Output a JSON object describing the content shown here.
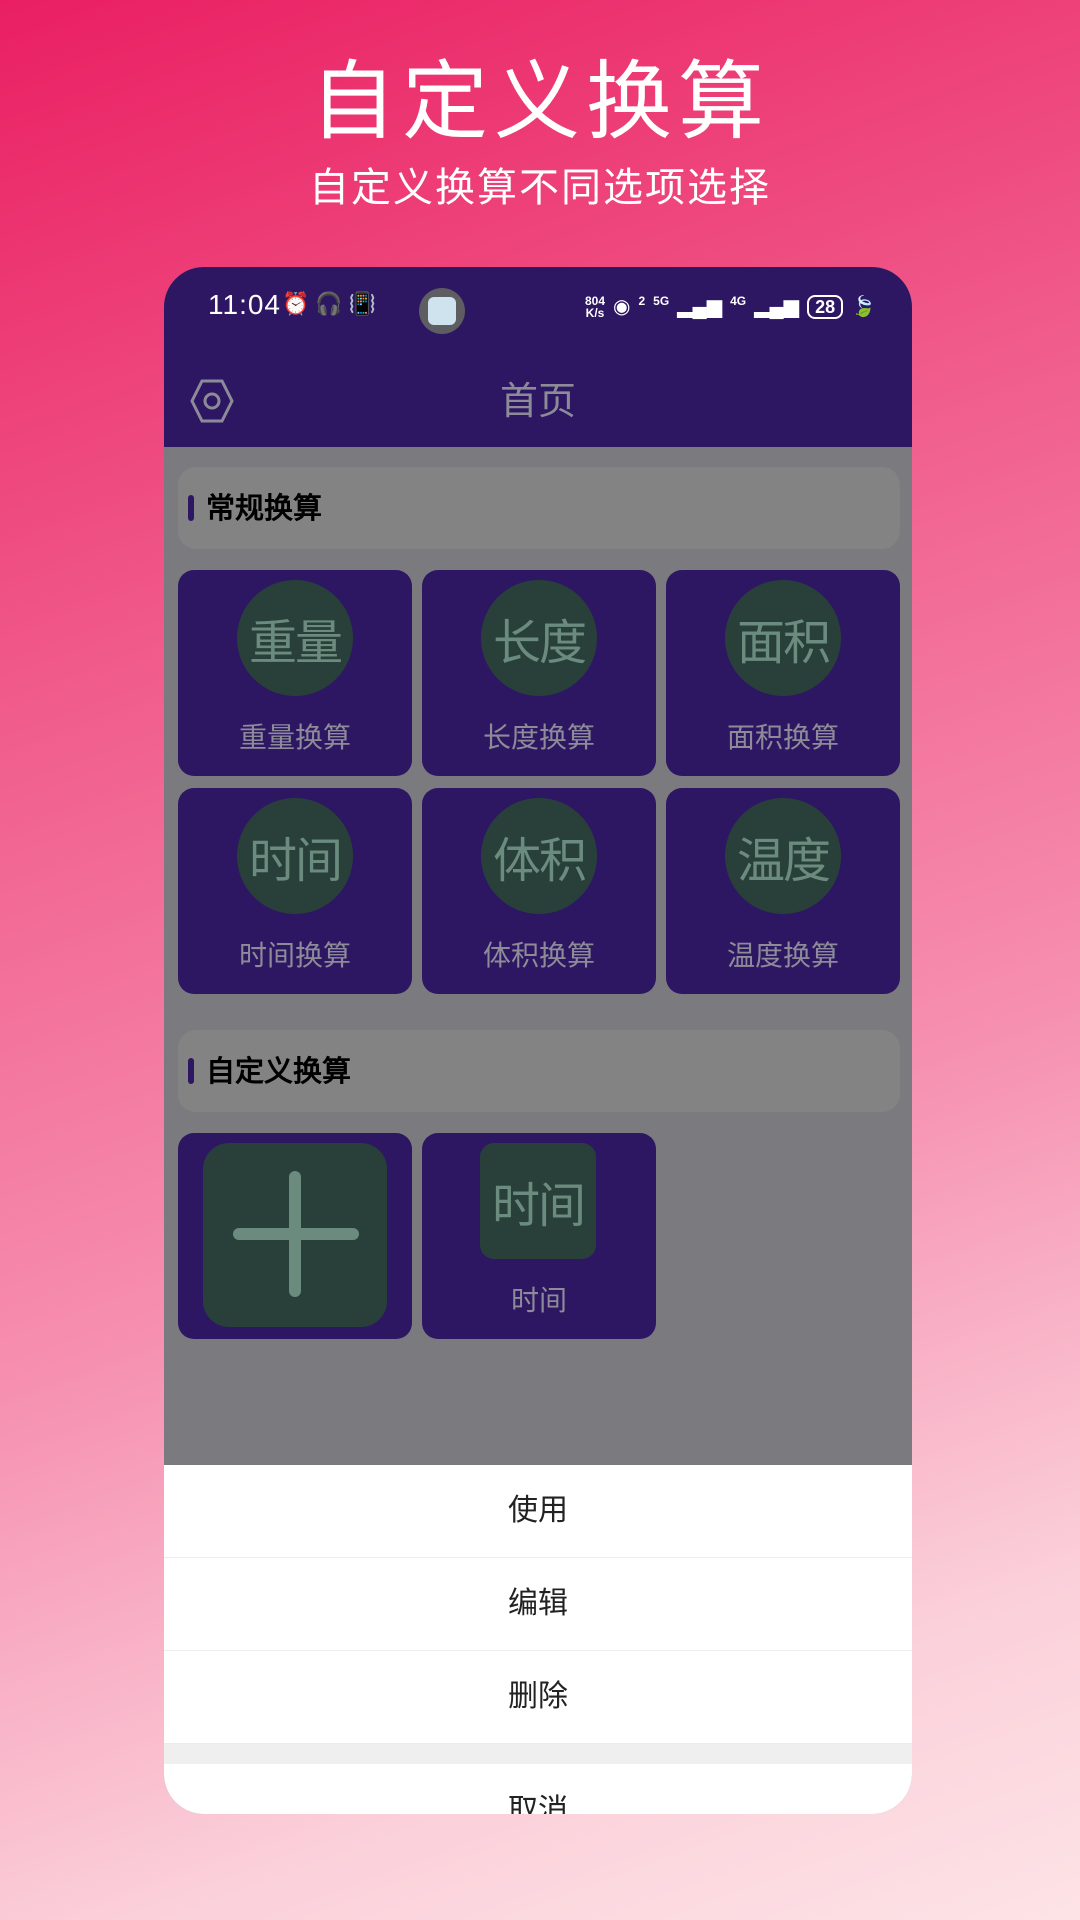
{
  "promo": {
    "title": "自定义换算",
    "subtitle": "自定义换算不同选项选择"
  },
  "status_bar": {
    "time": "11:04",
    "net_speed_value": "804",
    "net_speed_unit": "K/s",
    "sim1_label": "5G",
    "sim1_index": "2",
    "sim2_label": "4G",
    "battery": "28"
  },
  "nav": {
    "title": "首页"
  },
  "sections": {
    "regular": "常规换算",
    "custom": "自定义换算"
  },
  "regular_cards": [
    {
      "icon_text": "重量",
      "label": "重量换算"
    },
    {
      "icon_text": "长度",
      "label": "长度换算"
    },
    {
      "icon_text": "面积",
      "label": "面积换算"
    },
    {
      "icon_text": "时间",
      "label": "时间换算"
    },
    {
      "icon_text": "体积",
      "label": "体积换算"
    },
    {
      "icon_text": "温度",
      "label": "温度换算"
    }
  ],
  "custom_cards": [
    {
      "icon_text": "时间",
      "label": "时间"
    }
  ],
  "action_sheet": {
    "use": "使用",
    "edit": "编辑",
    "delete": "删除",
    "cancel": "取消"
  },
  "colors": {
    "primary": "#2d1763",
    "icon_bg": "#284039",
    "icon_fg": "#6b8b7e"
  }
}
